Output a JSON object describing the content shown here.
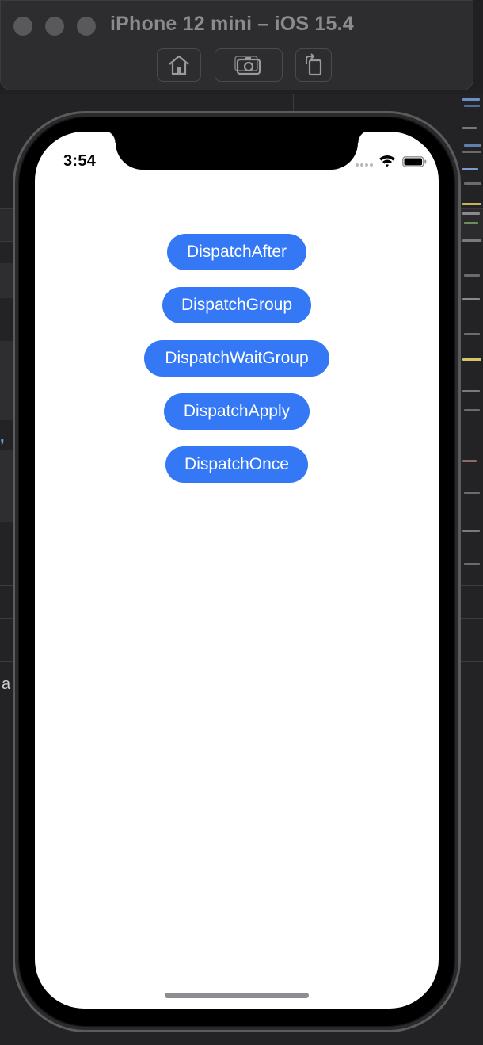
{
  "simulator": {
    "title": "iPhone 12 mini – iOS 15.4",
    "toolbar": [
      {
        "name": "home",
        "icon": "home-icon"
      },
      {
        "name": "screenshot",
        "icon": "camera-icon"
      },
      {
        "name": "rotate",
        "icon": "rotate-icon"
      }
    ]
  },
  "status_bar": {
    "time": "3:54",
    "icons": [
      "signal-dots-icon",
      "wifi-icon",
      "battery-icon"
    ]
  },
  "buttons": [
    {
      "label": "DispatchAfter"
    },
    {
      "label": "DispatchGroup"
    },
    {
      "label": "DispatchWaitGroup"
    },
    {
      "label": "DispatchApply"
    },
    {
      "label": "DispatchOnce"
    }
  ],
  "colors": {
    "button_background": "#3478f6",
    "button_text": "#ffffff",
    "screen_background": "#ffffff"
  },
  "background_editor": {
    "left_edge_letter": "a"
  }
}
